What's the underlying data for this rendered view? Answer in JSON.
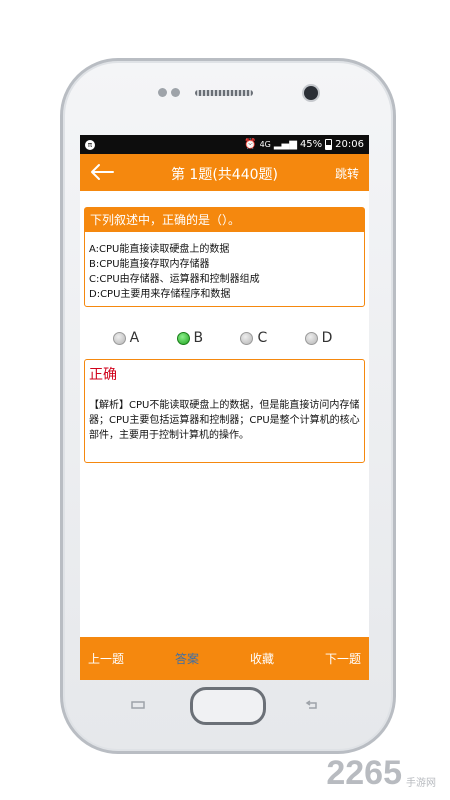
{
  "status_bar": {
    "signal": "4G",
    "battery": "45%",
    "time": "20:06"
  },
  "header": {
    "title": "第 1题(共440题)",
    "jump": "跳转"
  },
  "question": {
    "prompt": "下列叙述中，正确的是（）。",
    "options": [
      "A:CPU能直接读取硬盘上的数据",
      "B:CPU能直接存取内存储器",
      "C:CPU由存储器、运算器和控制器组成",
      "D:CPU主要用来存储程序和数据"
    ]
  },
  "choices": [
    {
      "label": "A",
      "selected": false
    },
    {
      "label": "B",
      "selected": true
    },
    {
      "label": "C",
      "selected": false
    },
    {
      "label": "D",
      "selected": false
    }
  ],
  "answer": {
    "result": "正确",
    "analysis": "【解析】CPU不能读取硬盘上的数据，但是能直接访问内存储器；CPU主要包括运算器和控制器；CPU是整个计算机的核心部件，主要用于控制计算机的操作。"
  },
  "bottom_bar": {
    "prev": "上一题",
    "answer": "答案",
    "favorite": "收藏",
    "next": "下一题"
  },
  "watermark": {
    "number": "2265",
    "text_line1": "手游网",
    "text_line2": ""
  },
  "colors": {
    "accent": "#f5880e",
    "result": "#d0021b",
    "selected": "#1fa31f"
  }
}
